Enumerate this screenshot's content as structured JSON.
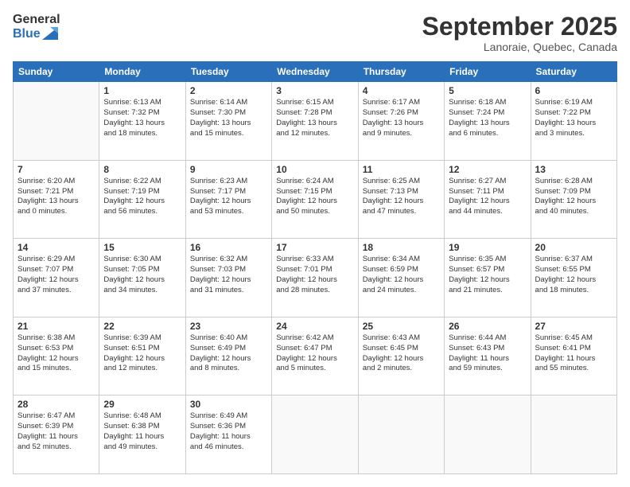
{
  "header": {
    "logo_line1": "General",
    "logo_line2": "Blue",
    "month": "September 2025",
    "location": "Lanoraie, Quebec, Canada"
  },
  "weekdays": [
    "Sunday",
    "Monday",
    "Tuesday",
    "Wednesday",
    "Thursday",
    "Friday",
    "Saturday"
  ],
  "weeks": [
    [
      {
        "day": "",
        "info": ""
      },
      {
        "day": "1",
        "info": "Sunrise: 6:13 AM\nSunset: 7:32 PM\nDaylight: 13 hours\nand 18 minutes."
      },
      {
        "day": "2",
        "info": "Sunrise: 6:14 AM\nSunset: 7:30 PM\nDaylight: 13 hours\nand 15 minutes."
      },
      {
        "day": "3",
        "info": "Sunrise: 6:15 AM\nSunset: 7:28 PM\nDaylight: 13 hours\nand 12 minutes."
      },
      {
        "day": "4",
        "info": "Sunrise: 6:17 AM\nSunset: 7:26 PM\nDaylight: 13 hours\nand 9 minutes."
      },
      {
        "day": "5",
        "info": "Sunrise: 6:18 AM\nSunset: 7:24 PM\nDaylight: 13 hours\nand 6 minutes."
      },
      {
        "day": "6",
        "info": "Sunrise: 6:19 AM\nSunset: 7:22 PM\nDaylight: 13 hours\nand 3 minutes."
      }
    ],
    [
      {
        "day": "7",
        "info": "Sunrise: 6:20 AM\nSunset: 7:21 PM\nDaylight: 13 hours\nand 0 minutes."
      },
      {
        "day": "8",
        "info": "Sunrise: 6:22 AM\nSunset: 7:19 PM\nDaylight: 12 hours\nand 56 minutes."
      },
      {
        "day": "9",
        "info": "Sunrise: 6:23 AM\nSunset: 7:17 PM\nDaylight: 12 hours\nand 53 minutes."
      },
      {
        "day": "10",
        "info": "Sunrise: 6:24 AM\nSunset: 7:15 PM\nDaylight: 12 hours\nand 50 minutes."
      },
      {
        "day": "11",
        "info": "Sunrise: 6:25 AM\nSunset: 7:13 PM\nDaylight: 12 hours\nand 47 minutes."
      },
      {
        "day": "12",
        "info": "Sunrise: 6:27 AM\nSunset: 7:11 PM\nDaylight: 12 hours\nand 44 minutes."
      },
      {
        "day": "13",
        "info": "Sunrise: 6:28 AM\nSunset: 7:09 PM\nDaylight: 12 hours\nand 40 minutes."
      }
    ],
    [
      {
        "day": "14",
        "info": "Sunrise: 6:29 AM\nSunset: 7:07 PM\nDaylight: 12 hours\nand 37 minutes."
      },
      {
        "day": "15",
        "info": "Sunrise: 6:30 AM\nSunset: 7:05 PM\nDaylight: 12 hours\nand 34 minutes."
      },
      {
        "day": "16",
        "info": "Sunrise: 6:32 AM\nSunset: 7:03 PM\nDaylight: 12 hours\nand 31 minutes."
      },
      {
        "day": "17",
        "info": "Sunrise: 6:33 AM\nSunset: 7:01 PM\nDaylight: 12 hours\nand 28 minutes."
      },
      {
        "day": "18",
        "info": "Sunrise: 6:34 AM\nSunset: 6:59 PM\nDaylight: 12 hours\nand 24 minutes."
      },
      {
        "day": "19",
        "info": "Sunrise: 6:35 AM\nSunset: 6:57 PM\nDaylight: 12 hours\nand 21 minutes."
      },
      {
        "day": "20",
        "info": "Sunrise: 6:37 AM\nSunset: 6:55 PM\nDaylight: 12 hours\nand 18 minutes."
      }
    ],
    [
      {
        "day": "21",
        "info": "Sunrise: 6:38 AM\nSunset: 6:53 PM\nDaylight: 12 hours\nand 15 minutes."
      },
      {
        "day": "22",
        "info": "Sunrise: 6:39 AM\nSunset: 6:51 PM\nDaylight: 12 hours\nand 12 minutes."
      },
      {
        "day": "23",
        "info": "Sunrise: 6:40 AM\nSunset: 6:49 PM\nDaylight: 12 hours\nand 8 minutes."
      },
      {
        "day": "24",
        "info": "Sunrise: 6:42 AM\nSunset: 6:47 PM\nDaylight: 12 hours\nand 5 minutes."
      },
      {
        "day": "25",
        "info": "Sunrise: 6:43 AM\nSunset: 6:45 PM\nDaylight: 12 hours\nand 2 minutes."
      },
      {
        "day": "26",
        "info": "Sunrise: 6:44 AM\nSunset: 6:43 PM\nDaylight: 11 hours\nand 59 minutes."
      },
      {
        "day": "27",
        "info": "Sunrise: 6:45 AM\nSunset: 6:41 PM\nDaylight: 11 hours\nand 55 minutes."
      }
    ],
    [
      {
        "day": "28",
        "info": "Sunrise: 6:47 AM\nSunset: 6:39 PM\nDaylight: 11 hours\nand 52 minutes."
      },
      {
        "day": "29",
        "info": "Sunrise: 6:48 AM\nSunset: 6:38 PM\nDaylight: 11 hours\nand 49 minutes."
      },
      {
        "day": "30",
        "info": "Sunrise: 6:49 AM\nSunset: 6:36 PM\nDaylight: 11 hours\nand 46 minutes."
      },
      {
        "day": "",
        "info": ""
      },
      {
        "day": "",
        "info": ""
      },
      {
        "day": "",
        "info": ""
      },
      {
        "day": "",
        "info": ""
      }
    ]
  ]
}
